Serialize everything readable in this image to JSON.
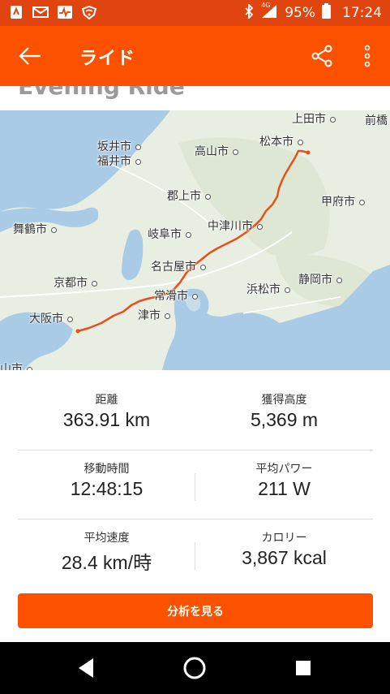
{
  "status_bar": {
    "battery": "95%",
    "time": "17:24",
    "network": "4G",
    "icons": [
      "strava-notification-icon",
      "mail-notification-icon",
      "activity-notification-icon",
      "wifi-notification-icon",
      "bluetooth-icon",
      "signal-icon",
      "battery-icon"
    ]
  },
  "app_bar": {
    "title": "ライド",
    "back_icon": "arrow-left-icon",
    "share_icon": "share-icon",
    "more_icon": "more-vertical-icon"
  },
  "activity_title_peek": "Evening Ride",
  "map": {
    "cities": [
      {
        "name": "上田市"
      },
      {
        "name": "前橋"
      },
      {
        "name": "松本市"
      },
      {
        "name": "坂井市"
      },
      {
        "name": "福井市"
      },
      {
        "name": "高山市"
      },
      {
        "name": "郡上市"
      },
      {
        "name": "甲府市"
      },
      {
        "name": "中津川市"
      },
      {
        "name": "舞鶴市"
      },
      {
        "name": "岐阜市"
      },
      {
        "name": "名古屋市"
      },
      {
        "name": "京都市"
      },
      {
        "name": "浜松市"
      },
      {
        "name": "静岡市"
      },
      {
        "name": "常滑市"
      },
      {
        "name": "大阪市"
      },
      {
        "name": "津市"
      },
      {
        "name": "歌山市"
      }
    ],
    "route_color": "#e8501a"
  },
  "stats": [
    {
      "label": "距離",
      "value": "363.91 km"
    },
    {
      "label": "獲得高度",
      "value": "5,369 m"
    },
    {
      "label": "移動時間",
      "value": "12:48:15"
    },
    {
      "label": "平均パワー",
      "value": "211 W"
    },
    {
      "label": "平均速度",
      "value": "28.4 km/時"
    },
    {
      "label": "カロリー",
      "value": "3,867 kcal"
    }
  ],
  "analyze_button": "分析を見る",
  "colors": {
    "brand": "#fc5200",
    "status_bar": "#e0450f",
    "water": "#a9cbe6",
    "land": "#e9eee2"
  },
  "nav": {
    "back_icon": "nav-back-icon",
    "home_icon": "nav-home-icon",
    "recents_icon": "nav-recents-icon"
  }
}
